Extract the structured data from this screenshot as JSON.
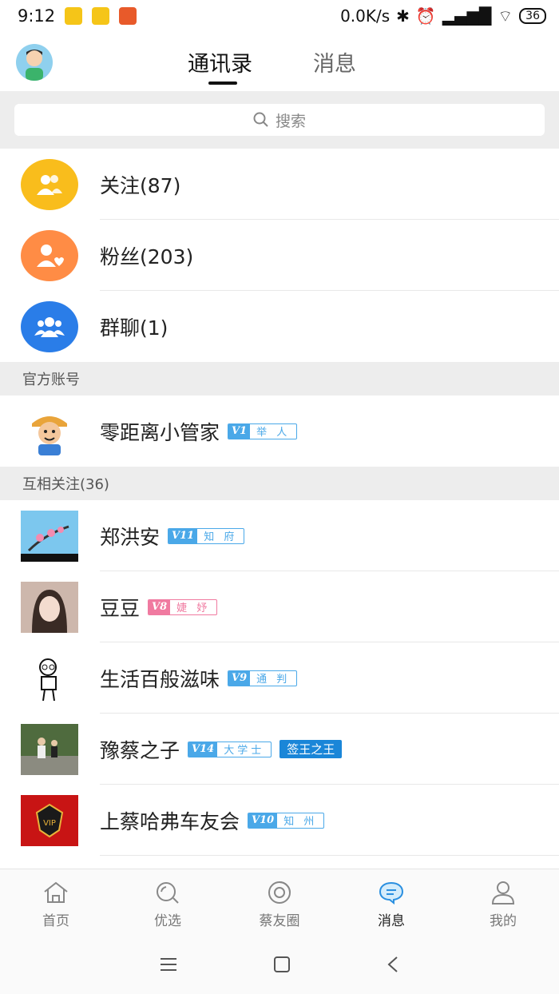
{
  "status_bar": {
    "time": "9:12",
    "network_speed": "0.0K/s",
    "battery": "36"
  },
  "header": {
    "tabs": [
      {
        "label": "通讯录",
        "active": true
      },
      {
        "label": "消息",
        "active": false
      }
    ]
  },
  "search": {
    "placeholder": "搜索"
  },
  "groups": [
    {
      "label": "关注(87)",
      "icon": "follow-icon",
      "color": "#f9bd1c"
    },
    {
      "label": "粉丝(203)",
      "icon": "fans-icon",
      "color": "#ff8c45"
    },
    {
      "label": "群聊(1)",
      "icon": "group-chat-icon",
      "color": "#2a7de8"
    }
  ],
  "official": {
    "header": "官方账号",
    "name": "零距离小管家",
    "level": "V1",
    "title": "举 人"
  },
  "mutual": {
    "header": "互相关注(36)",
    "contacts": [
      {
        "name": "郑洪安",
        "level": "V11",
        "title": "知 府",
        "badge_color": "blue"
      },
      {
        "name": "豆豆",
        "level": "V8",
        "title": "婕 妤",
        "badge_color": "pink"
      },
      {
        "name": "生活百般滋味",
        "level": "V9",
        "title": "通 判",
        "badge_color": "blue"
      },
      {
        "name": "豫蔡之子",
        "level": "V14",
        "title": "大学士",
        "badge_color": "blue",
        "extra_tag": "签王之王"
      },
      {
        "name": "上蔡哈弗车友会",
        "level": "V10",
        "title": "知 州",
        "badge_color": "blue"
      }
    ]
  },
  "bottom_nav": [
    {
      "label": "首页",
      "icon": "home-icon",
      "active": false
    },
    {
      "label": "优选",
      "icon": "search-discover-icon",
      "active": false
    },
    {
      "label": "蔡友圈",
      "icon": "moments-icon",
      "active": false
    },
    {
      "label": "消息",
      "icon": "message-icon",
      "active": true
    },
    {
      "label": "我的",
      "icon": "profile-icon",
      "active": false
    }
  ],
  "colors": {
    "accent": "#1a86d8",
    "divider_bg": "#ededed"
  }
}
